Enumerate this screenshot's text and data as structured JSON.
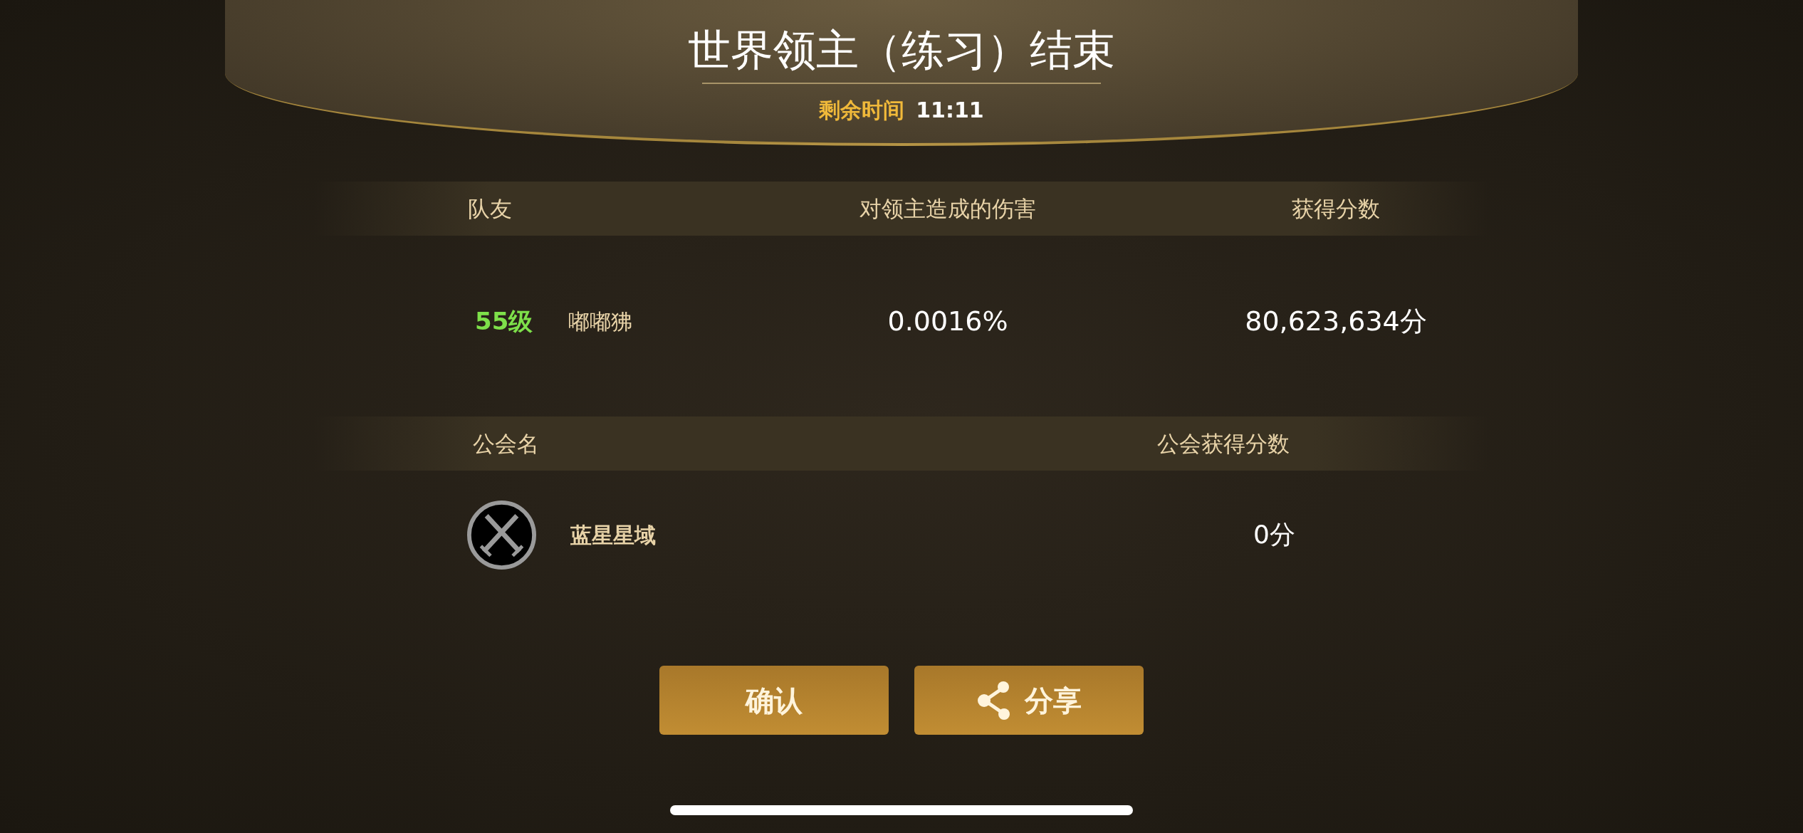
{
  "header": {
    "title": "世界领主（练习）结束",
    "timer_label": "剩余时间",
    "timer_value": "11:11"
  },
  "teammates": {
    "columns": [
      "队友",
      "对领主造成的伤害",
      "获得分数"
    ],
    "rows": [
      {
        "level": "55级",
        "name": "嘟嘟狒",
        "damage": "0.0016%",
        "score": "80,623,634分"
      }
    ]
  },
  "guild": {
    "columns": [
      "公会名",
      "公会获得分数"
    ],
    "rows": [
      {
        "name": "蓝星星域",
        "score": "0分"
      }
    ]
  },
  "buttons": [
    {
      "label": "确认",
      "kind": "plain"
    },
    {
      "label": "分享",
      "kind": "share"
    }
  ]
}
